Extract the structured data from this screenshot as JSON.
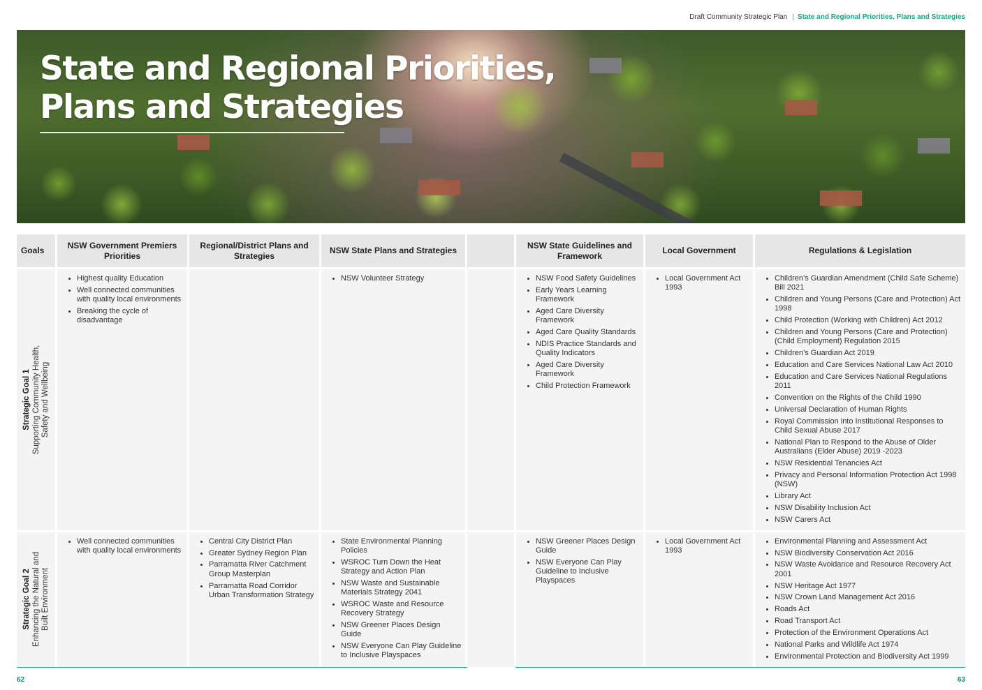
{
  "running_head": {
    "document": "Draft Community Strategic Plan",
    "separator": "|",
    "section": "State and Regional Priorities, Plans and Strategies"
  },
  "hero": {
    "title_line1": "State and Regional Priorities,",
    "title_line2": "Plans and Strategies",
    "image": "aerial-suburb-photo"
  },
  "table": {
    "headers": {
      "goals": "Goals",
      "premiers": "NSW Government Premiers Priorities",
      "regional": "Regional/District Plans and Strategies",
      "state_plans": "NSW State Plans and Strategies",
      "blank": "",
      "guidelines": "NSW State Guidelines and Framework",
      "local": "Local Government",
      "regulations": "Regulations & Legislation"
    },
    "rows": [
      {
        "goal_title": "Strategic Goal 1",
        "goal_line1": "Supporting Community Health,",
        "goal_line2": "Safety and Wellbeing",
        "premiers": [
          "Highest quality Education",
          "Well connected communities with quality local environments",
          "Breaking the cycle of disadvantage"
        ],
        "regional": [],
        "state_plans": [
          "NSW Volunteer Strategy"
        ],
        "blank": [],
        "guidelines": [
          "NSW Food Safety Guidelines",
          "Early Years Learning Framework",
          "Aged Care Diversity Framework",
          "Aged Care Quality Standards",
          "NDIS Practice Standards and Quality Indicators",
          "Aged Care Diversity Framework",
          "Child Protection Framework"
        ],
        "local": [
          "Local Government Act 1993"
        ],
        "regulations": [
          "Children’s Guardian Amendment (Child Safe Scheme) Bill 2021",
          "Children and Young Persons (Care and Protection) Act 1998",
          "Child Protection (Working with Children) Act 2012",
          "Children and Young Persons (Care and Protection) (Child Employment) Regulation 2015",
          "Children’s Guardian Act 2019",
          "Education and Care Services National Law Act 2010",
          "Education and Care Services National Regulations 2011",
          "Convention on the Rights of the Child 1990",
          "Universal Declaration of Human Rights",
          "Royal Commission into Institutional Responses to Child Sexual Abuse 2017",
          "National Plan to Respond to the Abuse of Older Australians (Elder Abuse) 2019 -2023",
          "NSW Residential Tenancies Act",
          "Privacy and Personal Information Protection Act 1998 (NSW)",
          "Library Act",
          "NSW Disability Inclusion Act",
          "NSW Carers Act"
        ]
      },
      {
        "goal_title": "Strategic Goal 2",
        "goal_line1": "Enhancing the Natural and",
        "goal_line2": "Built Environment",
        "premiers": [
          "Well connected communities with quality local environments"
        ],
        "regional": [
          "Central City District Plan",
          "Greater Sydney Region Plan",
          "Parramatta River Catchment Group Masterplan",
          "Parramatta Road Corridor Urban Transformation Strategy"
        ],
        "state_plans": [
          "State Environmental Planning Policies",
          "WSROC Turn Down the Heat Strategy and Action Plan",
          "NSW Waste and Sustainable Materials Strategy 2041",
          "WSROC Waste and Resource Recovery Strategy",
          "NSW Greener Places Design Guide",
          "NSW Everyone Can Play Guideline to Inclusive Playspaces"
        ],
        "blank": [],
        "guidelines": [
          "NSW Greener Places Design Guide",
          "NSW Everyone Can Play Guideline to Inclusive Playspaces"
        ],
        "local": [
          "Local Government Act 1993"
        ],
        "regulations": [
          "Environmental Planning and Assessment Act",
          "NSW Biodiversity Conservation Act 2016",
          "NSW Waste Avoidance and Resource Recovery Act 2001",
          "NSW Heritage Act 1977",
          "NSW Crown Land Management Act 2016",
          "Roads Act",
          "Road Transport Act",
          "Protection of the Environment Operations Act",
          "National Parks and Wildlife Act 1974",
          "Environmental Protection and Biodiversity Act  1999"
        ]
      }
    ]
  },
  "footer": {
    "page_left": "62",
    "page_right": "63",
    "rule_color": "#1aa383"
  },
  "colors": {
    "accent": "#1aa383",
    "header_bg": "#e6e6e6",
    "cell_bg": "#f4f4f4"
  }
}
